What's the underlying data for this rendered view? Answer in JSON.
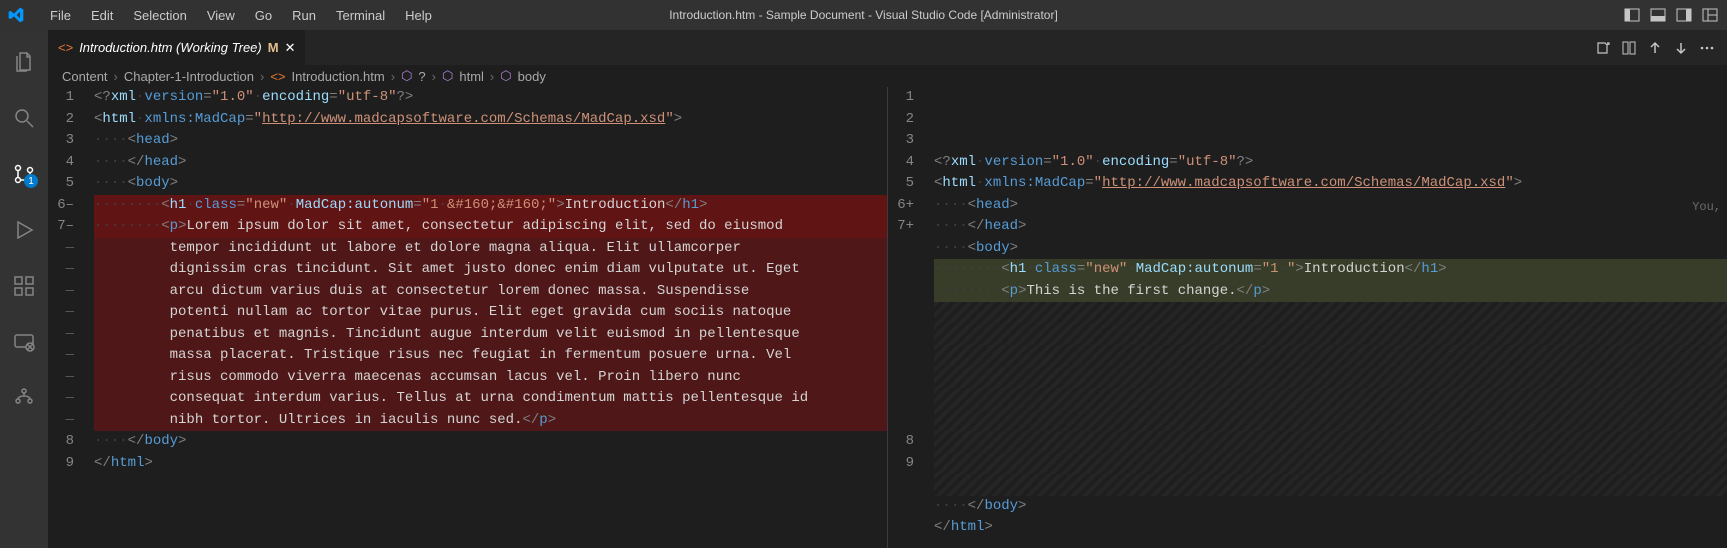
{
  "title": "Introduction.htm - Sample Document - Visual Studio Code [Administrator]",
  "menu": [
    "File",
    "Edit",
    "Selection",
    "View",
    "Go",
    "Run",
    "Terminal",
    "Help"
  ],
  "tab": {
    "label": "Introduction.htm (Working Tree)",
    "modified": "M"
  },
  "breadcrumbs": {
    "parts": [
      "Content",
      "Chapter-1-Introduction",
      "Introduction.htm",
      "?",
      "html",
      "body"
    ]
  },
  "scm_badge": "1",
  "author_label": "You,",
  "left": {
    "lines": [
      {
        "n": "1",
        "t": "xml_pi"
      },
      {
        "n": "2",
        "t": "html_open"
      },
      {
        "n": "3",
        "t": "head_open"
      },
      {
        "n": "4",
        "t": "head_close"
      },
      {
        "n": "5",
        "t": "body_open"
      },
      {
        "n": "6–",
        "t": "h1_del",
        "cls": "del-strong"
      },
      {
        "n": "7–",
        "t": "p_del_1",
        "cls": "del-strong"
      },
      {
        "n": "dash",
        "t": "p_del_2",
        "cls": "del"
      },
      {
        "n": "dash",
        "t": "p_del_3",
        "cls": "del"
      },
      {
        "n": "dash",
        "t": "p_del_4",
        "cls": "del"
      },
      {
        "n": "dash",
        "t": "p_del_5",
        "cls": "del"
      },
      {
        "n": "dash",
        "t": "p_del_6",
        "cls": "del"
      },
      {
        "n": "dash",
        "t": "p_del_7",
        "cls": "del"
      },
      {
        "n": "dash",
        "t": "p_del_8",
        "cls": "del"
      },
      {
        "n": "dash",
        "t": "p_del_9",
        "cls": "del"
      },
      {
        "n": "dash",
        "t": "p_del_10",
        "cls": "del"
      },
      {
        "n": "8",
        "t": "body_close"
      },
      {
        "n": "9",
        "t": "html_close"
      }
    ]
  },
  "right": {
    "lines": [
      {
        "n": "1",
        "t": "xml_pi"
      },
      {
        "n": "2",
        "t": "html_open"
      },
      {
        "n": "3",
        "t": "head_open"
      },
      {
        "n": "4",
        "t": "head_close"
      },
      {
        "n": "5",
        "t": "body_open"
      },
      {
        "n": "6+",
        "t": "h1_add",
        "cls": "add"
      },
      {
        "n": "7+",
        "t": "p_add",
        "cls": "add"
      },
      {
        "n": "",
        "t": "",
        "cls": "stripes"
      },
      {
        "n": "",
        "t": "",
        "cls": "stripes"
      },
      {
        "n": "",
        "t": "",
        "cls": "stripes"
      },
      {
        "n": "",
        "t": "",
        "cls": "stripes"
      },
      {
        "n": "",
        "t": "",
        "cls": "stripes"
      },
      {
        "n": "",
        "t": "",
        "cls": "stripes"
      },
      {
        "n": "",
        "t": "",
        "cls": "stripes"
      },
      {
        "n": "",
        "t": "",
        "cls": "stripes"
      },
      {
        "n": "",
        "t": "",
        "cls": "stripes"
      },
      {
        "n": "8",
        "t": "body_close"
      },
      {
        "n": "9",
        "t": "html_close"
      }
    ]
  },
  "tokens": {
    "xml_pi": {
      "raw": "<?xml·version=\"1.0\"·encoding=\"utf-8\"?>"
    },
    "html_open": {
      "raw": "<html·xmlns:MadCap=\"http://www.madcapsoftware.com/Schemas/MadCap.xsd\">"
    },
    "head_open": {
      "raw": "····<head>"
    },
    "head_close": {
      "raw": "····</head>"
    },
    "body_open": {
      "raw": "····<body>"
    },
    "h1_del": {
      "raw": "········<h1·class=\"new\"·MadCap:autonum=\"1·&#160;&#160;\">Introduction</h1>"
    },
    "h1_add": {
      "raw": "········<h1·class=\"new\"·MadCap:autonum=\"1·\">Introduction</h1>"
    },
    "p_del_1": {
      "raw": "········<p>Lorem ipsum dolor sit amet, consectetur adipiscing elit, sed do eiusmod"
    },
    "p_del_2": {
      "raw": "         tempor incididunt ut labore et dolore magna aliqua. Elit ullamcorper"
    },
    "p_del_3": {
      "raw": "         dignissim cras tincidunt. Sit amet justo donec enim diam vulputate ut. Eget"
    },
    "p_del_4": {
      "raw": "         arcu dictum varius duis at consectetur lorem donec massa. Suspendisse"
    },
    "p_del_5": {
      "raw": "         potenti nullam ac tortor vitae purus. Elit eget gravida cum sociis natoque"
    },
    "p_del_6": {
      "raw": "         penatibus et magnis. Tincidunt augue interdum velit euismod in pellentesque"
    },
    "p_del_7": {
      "raw": "         massa placerat. Tristique risus nec feugiat in fermentum posuere urna. Vel"
    },
    "p_del_8": {
      "raw": "         risus commodo viverra maecenas accumsan lacus vel. Proin libero nunc"
    },
    "p_del_9": {
      "raw": "         consequat interdum varius. Tellus at urna condimentum mattis pellentesque id"
    },
    "p_del_10": {
      "raw": "         nibh tortor. Ultrices in iaculis nunc sed.</p>"
    },
    "p_add": {
      "raw": "········<p>This is the first change.</p>"
    },
    "body_close": {
      "raw": "····</body>"
    },
    "html_close": {
      "raw": "</html>"
    }
  }
}
